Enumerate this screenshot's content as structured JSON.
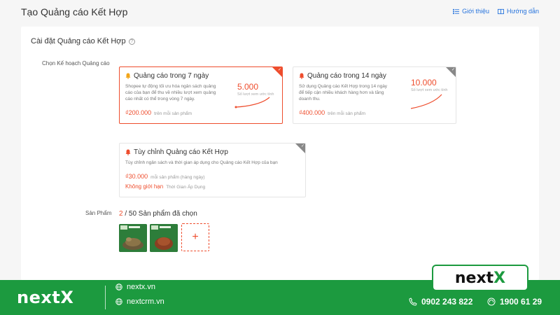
{
  "header": {
    "title": "Tạo Quảng cáo Kết Hợp",
    "intro_link": "Giới thiệu",
    "guide_link": "Hướng dẫn"
  },
  "settings": {
    "title": "Cài đặt Quảng cáo Kết Hợp",
    "plan_label": "Chọn Kế hoạch Quảng cáo",
    "product_label": "Sản Phẩm"
  },
  "plans": [
    {
      "title": "Quảng cáo trong 7 ngày",
      "desc_lines": [
        "Shopee tự động tối ưu hóa ngân sách quảng",
        "cáo của bạn để thu về nhiều lượt xem quảng",
        "cáo nhất có thể trong vòng 7 ngày."
      ],
      "price": "₫200.000",
      "price_unit": "trên mỗi sản phẩm",
      "reach": "5.000",
      "reach_caption": "Số lượt xem ước tính",
      "selected": true
    },
    {
      "title": "Quảng cáo trong 14 ngày",
      "desc_lines": [
        "Sử dụng Quảng cáo Kết Hợp trong 14 ngày",
        "để tiếp cận nhiều khách hàng hơn và tăng",
        "doanh thu."
      ],
      "price": "₫400.000",
      "price_unit": "trên mỗi sản phẩm",
      "reach": "10.000",
      "reach_caption": "Số lượt xem ước tính",
      "selected": false
    },
    {
      "title": "Tùy chỉnh Quảng cáo Kết Hợp",
      "desc_lines": [
        "Tùy chỉnh ngân sách và thời gian áp dụng cho Quảng cáo Kết Hợp của bạn"
      ],
      "price": "₫30.000",
      "price_unit": "mỗi sản phẩm (hàng ngày)",
      "limit_text": "Không giới hạn",
      "limit_unit": "Thời Gian Áp Dụng",
      "selected": false
    }
  ],
  "products": {
    "selected": "2",
    "max_text": "/ 50 Sản phẩm đã chọn",
    "add_symbol": "+"
  },
  "footer": {
    "brand_main": "next",
    "brand_x": "X",
    "site1": "nextx.vn",
    "site2": "nextcrm.vn",
    "phone1": "0902 243 822",
    "phone2": "1900 61 29"
  },
  "colors": {
    "accent": "#ee4d2d",
    "link": "#2673dd",
    "footer_green": "#1c9a3f"
  }
}
